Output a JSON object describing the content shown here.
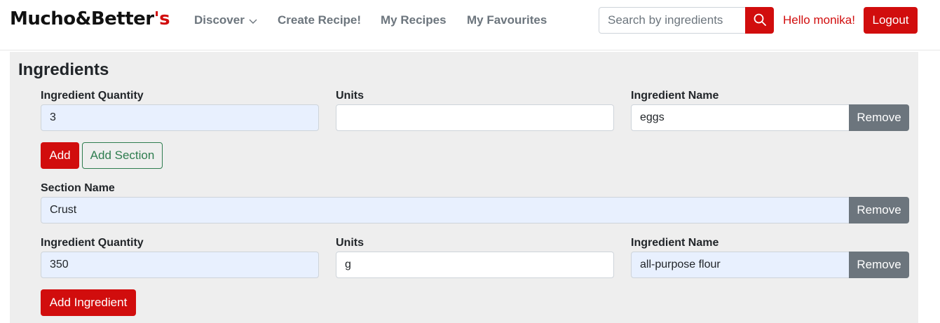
{
  "brand": {
    "name": "Mucho&Better",
    "suffix": "'s"
  },
  "nav": {
    "discover": "Discover",
    "create_recipe": "Create Recipe!",
    "my_recipes": "My Recipes",
    "my_favourites": "My Favourites"
  },
  "search": {
    "placeholder": "Search by ingredients",
    "value": ""
  },
  "user": {
    "greeting": "Hello monika!",
    "logout": "Logout"
  },
  "colors": {
    "accent": "#d10d0d",
    "outline_green": "#2e7d4f",
    "gray_button": "#6c757d",
    "panel_bg": "#eeeeee"
  },
  "ingredients": {
    "heading": "Ingredients",
    "row1": {
      "quantity_label": "Ingredient Quantity",
      "quantity": "3",
      "units_label": "Units",
      "units": "",
      "name_label": "Ingredient Name",
      "name": "eggs",
      "remove": "Remove"
    },
    "add": "Add",
    "add_section": "Add Section",
    "section": {
      "label": "Section Name",
      "value": "Crust",
      "remove": "Remove"
    },
    "row2": {
      "quantity_label": "Ingredient Quantity",
      "quantity": "350",
      "units_label": "Units",
      "units": "g",
      "name_label": "Ingredient Name",
      "name": "all-purpose flour",
      "remove": "Remove"
    },
    "add_ingredient": "Add Ingredient"
  }
}
